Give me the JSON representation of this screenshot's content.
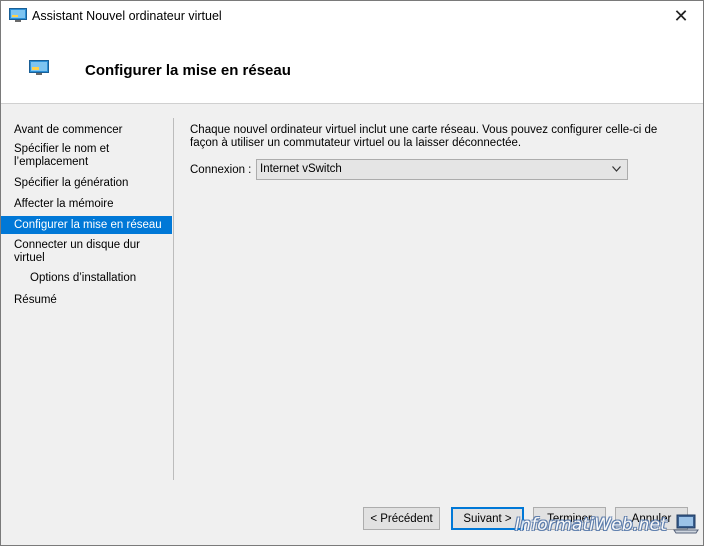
{
  "window": {
    "title": "Assistant Nouvel ordinateur virtuel",
    "close_glyph": "✕",
    "icon": "vm-window-icon"
  },
  "header": {
    "title": "Configurer la mise en réseau",
    "icon": "vm-window-icon"
  },
  "nav": {
    "items": [
      {
        "label": "Avant de commencer",
        "selected": false
      },
      {
        "label": "Spécifier le nom et l’emplacement",
        "selected": false
      },
      {
        "label": "Spécifier la génération",
        "selected": false
      },
      {
        "label": "Affecter la mémoire",
        "selected": false
      },
      {
        "label": "Configurer la mise en réseau",
        "selected": true
      },
      {
        "label": "Connecter un disque dur virtuel",
        "selected": false
      },
      {
        "label": "Options d’installation",
        "selected": false,
        "sub": true
      },
      {
        "label": "Résumé",
        "selected": false
      }
    ]
  },
  "main": {
    "description": "Chaque nouvel ordinateur virtuel inclut une carte réseau. Vous pouvez configurer celle-ci de façon à utiliser un commutateur virtuel ou la laisser déconnectée.",
    "connection_label": "Connexion :",
    "connection_value": "Internet vSwitch"
  },
  "footer": {
    "previous_label": "< Précédent",
    "next_label": "Suivant >",
    "finish_label": "Terminer",
    "cancel_label": "Annuler"
  },
  "watermark": {
    "text": "InformatiWeb.net"
  },
  "colors": {
    "accent": "#0078d7",
    "panel_bg": "#f0f0f0",
    "button_bg": "#e1e1e1"
  }
}
